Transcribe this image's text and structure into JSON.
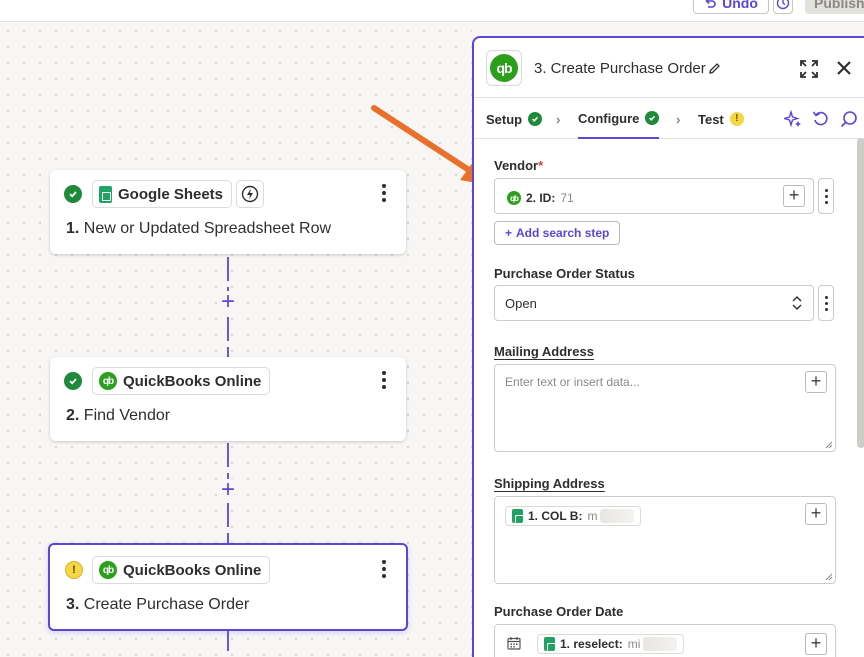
{
  "topbar": {
    "undo_label": "Undo",
    "publish_label": "Publish"
  },
  "canvas": {
    "nodes": [
      {
        "status": "ok",
        "app": "Google Sheets",
        "number": "1.",
        "title": "New or Updated Spreadsheet Row",
        "has_trigger_icon": true
      },
      {
        "status": "ok",
        "app": "QuickBooks Online",
        "number": "2.",
        "title": "Find Vendor"
      },
      {
        "status": "warning",
        "app": "QuickBooks Online",
        "number": "3.",
        "title": "Create Purchase Order",
        "selected": true
      }
    ],
    "add_step_symbol": "+"
  },
  "panel": {
    "app_icon_text": "qb",
    "title": "3. Create Purchase Order",
    "tabs": [
      {
        "label": "Setup",
        "state": "complete"
      },
      {
        "label": "Configure",
        "state": "complete",
        "active": true
      },
      {
        "label": "Test",
        "state": "warning",
        "warn_symbol": "!"
      }
    ],
    "fields": {
      "vendor": {
        "label": "Vendor",
        "required_mark": "*",
        "pill_step": "2. ID:",
        "pill_value": "71",
        "add_search_label": "Add search step",
        "add_search_symbol": "+"
      },
      "po_status": {
        "label": "Purchase Order Status",
        "value": "Open"
      },
      "mailing_address": {
        "label": "Mailing Address",
        "placeholder": "Enter text or insert data..."
      },
      "shipping_address": {
        "label": "Shipping Address",
        "pill_step": "1. COL B:",
        "pill_value": "m"
      },
      "po_date": {
        "label": "Purchase Order Date",
        "pill_step": "1. reselect:",
        "pill_value": "mi"
      }
    }
  },
  "colors": {
    "accent": "#5d45d8",
    "success": "#1f8a3a",
    "warning": "#f6d547",
    "quickbooks": "#2ca01c",
    "sheets": "#1fa463",
    "arrow": "#e8702a"
  },
  "icons": [
    "undo-icon",
    "history-icon",
    "check-icon",
    "warning-icon",
    "lightning-icon",
    "kebab-icon",
    "plus-icon",
    "pencil-icon",
    "expand-icon",
    "close-icon",
    "chevron-right-icon",
    "sparkle-icon",
    "refresh-icon",
    "search-icon",
    "chevron-updown-icon",
    "calendar-icon",
    "resize-handle-icon",
    "arrow-annotation"
  ]
}
